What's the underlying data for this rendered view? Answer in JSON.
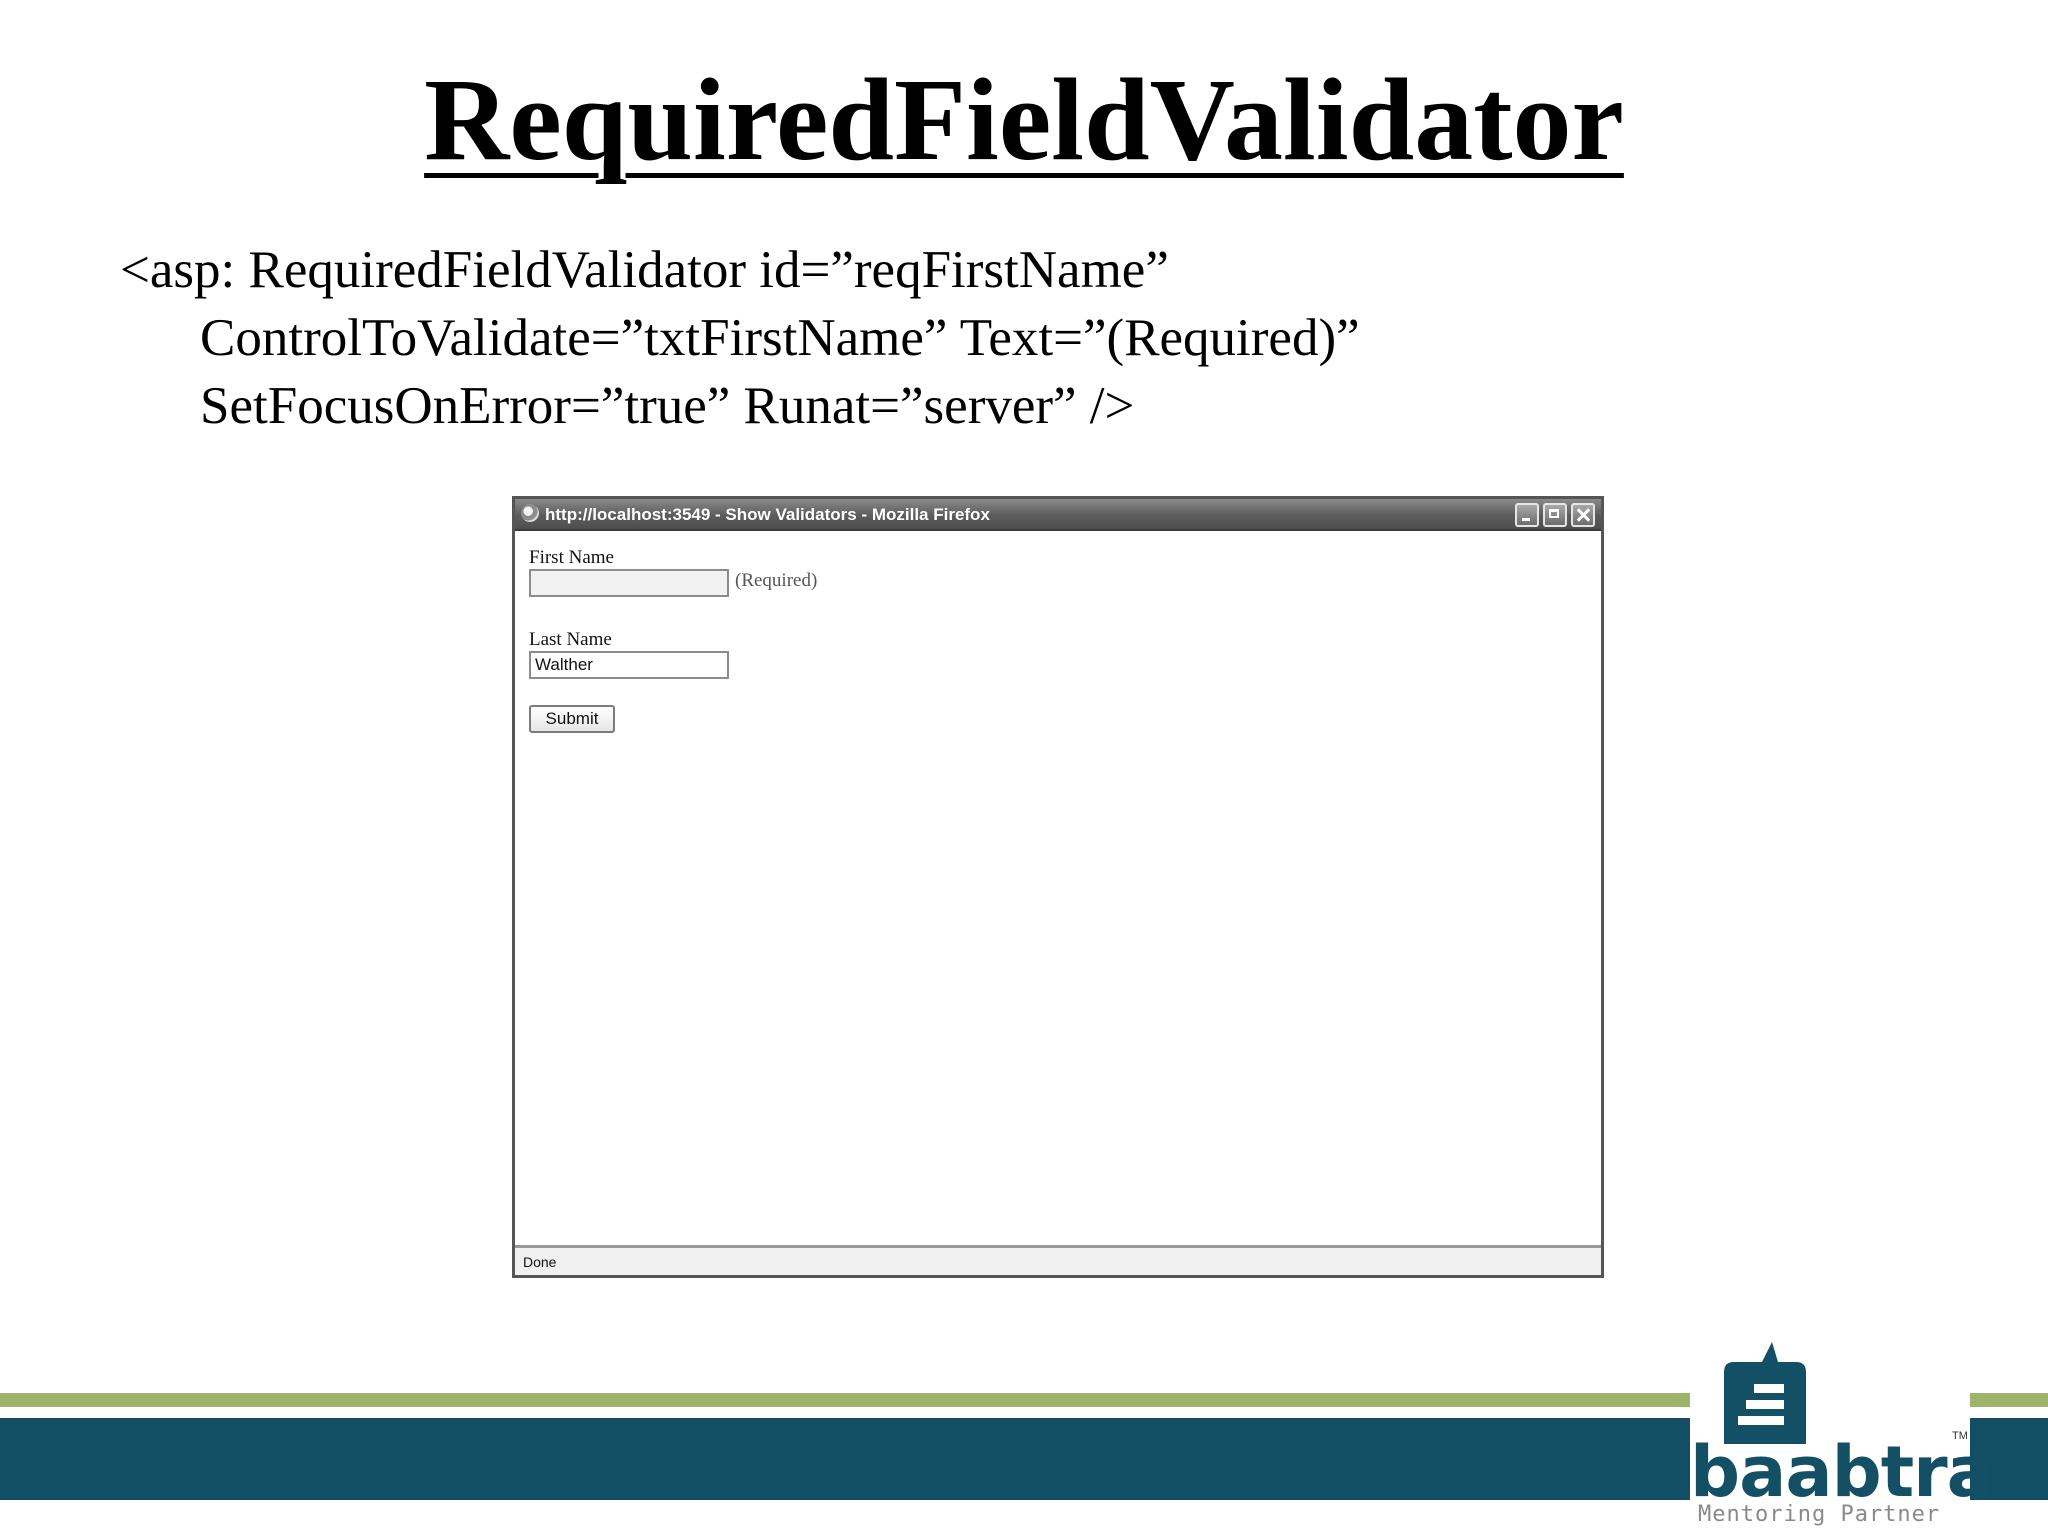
{
  "slide": {
    "title": "RequiredFieldValidator",
    "code_lines": [
      "<asp: RequiredFieldValidator id=”reqFirstName”",
      "ControlToValidate=”txtFirstName” Text=”(Required)”",
      "SetFocusOnError=”true” Runat=”server” />"
    ]
  },
  "browser": {
    "window_title": "http://localhost:3549 - Show Validators - Mozilla Firefox",
    "first_name_label": "First Name",
    "first_name_value": "",
    "required_message": "(Required)",
    "last_name_label": "Last Name",
    "last_name_value": "Walther",
    "submit_label": "Submit",
    "status_text": "Done"
  },
  "logo": {
    "wordmark": "baabtra",
    "trademark": "TM",
    "tagline": "Mentoring Partner"
  },
  "colors": {
    "footer_light_band": "#9db46a",
    "footer_dark_band": "#124f64",
    "logo_primary": "#135066"
  }
}
